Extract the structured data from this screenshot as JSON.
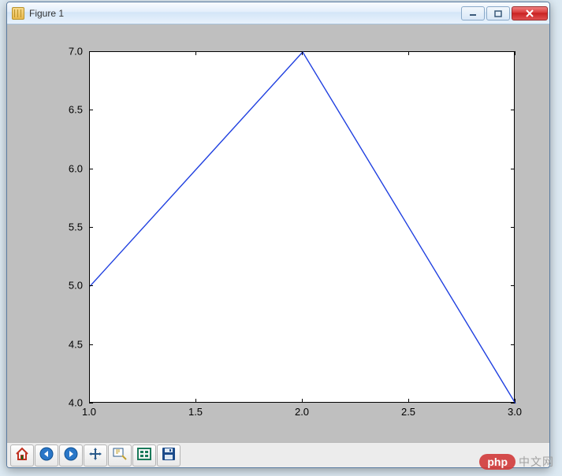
{
  "window": {
    "title": "Figure 1"
  },
  "chart_data": {
    "type": "line",
    "x": [
      1.0,
      2.0,
      3.0
    ],
    "y": [
      5.0,
      7.0,
      4.0
    ],
    "xlim": [
      1.0,
      3.0
    ],
    "ylim": [
      4.0,
      7.0
    ],
    "xticks": [
      1.0,
      1.5,
      2.0,
      2.5,
      3.0
    ],
    "yticks": [
      4.0,
      4.5,
      5.0,
      5.5,
      6.0,
      6.5,
      7.0
    ],
    "xtick_labels": [
      "1.0",
      "1.5",
      "2.0",
      "2.5",
      "3.0"
    ],
    "ytick_labels": [
      "4.0",
      "4.5",
      "5.0",
      "5.5",
      "6.0",
      "6.5",
      "7.0"
    ],
    "title": "",
    "xlabel": "",
    "ylabel": "",
    "line_color": "#2040e0"
  },
  "toolbar": {
    "buttons": [
      {
        "name": "home",
        "icon": "home-icon"
      },
      {
        "name": "back",
        "icon": "arrow-left-icon"
      },
      {
        "name": "forward",
        "icon": "arrow-right-icon"
      },
      {
        "name": "pan",
        "icon": "move-icon"
      },
      {
        "name": "zoom",
        "icon": "zoom-rect-icon"
      },
      {
        "name": "subplots",
        "icon": "configure-icon"
      },
      {
        "name": "save",
        "icon": "save-icon"
      }
    ]
  },
  "watermark": {
    "pill": "php",
    "text": "中文网"
  }
}
